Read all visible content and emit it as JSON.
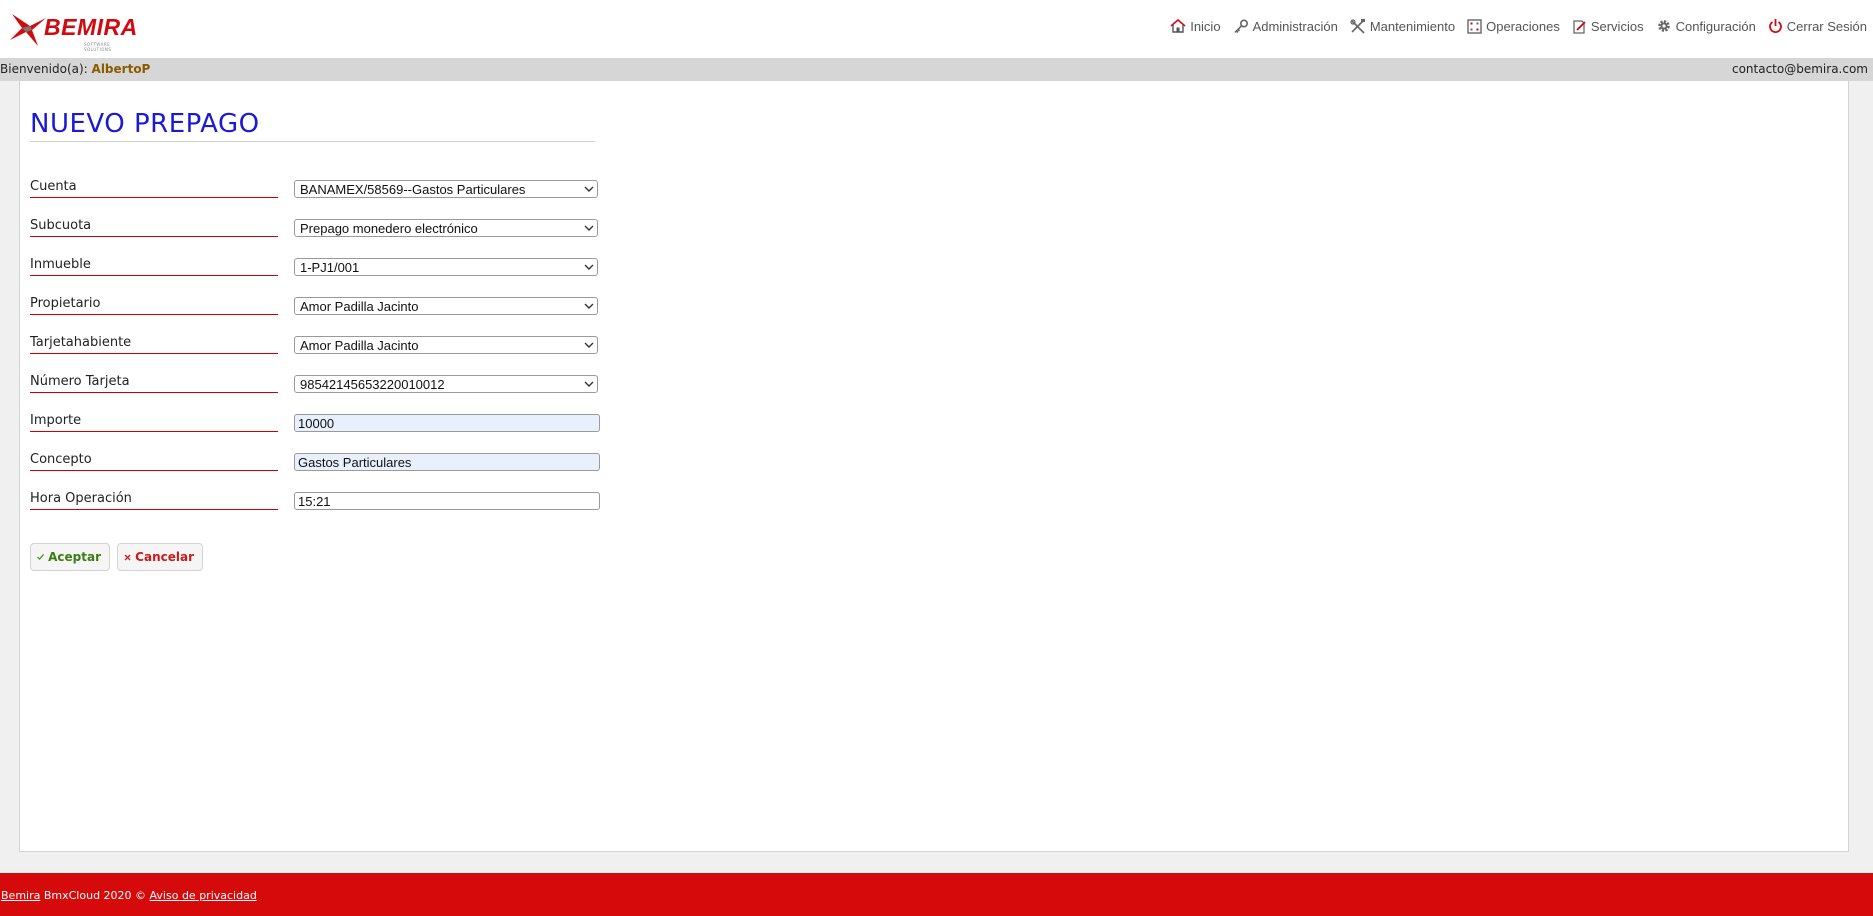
{
  "brand": {
    "logo_text": "BEMIRA",
    "logo_subtitle": "SOFTWARE SOLUTIONS",
    "accent_color": "#d10a10"
  },
  "nav": {
    "items": [
      {
        "label": "Inicio",
        "icon": "home-icon"
      },
      {
        "label": "Administración",
        "icon": "key-icon"
      },
      {
        "label": "Mantenimiento",
        "icon": "tools-icon"
      },
      {
        "label": "Operaciones",
        "icon": "calculator-icon"
      },
      {
        "label": "Servicios",
        "icon": "edit-document-icon"
      },
      {
        "label": "Configuración",
        "icon": "gear-icon"
      },
      {
        "label": "Cerrar Sesión",
        "icon": "power-icon"
      }
    ]
  },
  "welcome": {
    "prefix": "Bienvenido(a):",
    "user": "AlbertoP",
    "contact": "contacto@bemira.com"
  },
  "page": {
    "title": "NUEVO PREPAGO"
  },
  "form": {
    "fields": [
      {
        "label": "Cuenta",
        "value": "BANAMEX/58569--Gastos Particulares",
        "type": "select"
      },
      {
        "label": "Subcuota",
        "value": "Prepago monedero electrónico",
        "type": "select"
      },
      {
        "label": "Inmueble",
        "value": "1-PJ1/001",
        "type": "select"
      },
      {
        "label": "Propietario",
        "value": "Amor Padilla Jacinto",
        "type": "select"
      },
      {
        "label": "Tarjetahabiente",
        "value": "Amor Padilla Jacinto",
        "type": "select"
      },
      {
        "label": "Número Tarjeta",
        "value": "98542145653220010012",
        "type": "select"
      },
      {
        "label": "Importe",
        "value": "10000",
        "type": "text-filled"
      },
      {
        "label": "Concepto",
        "value": "Gastos Particulares",
        "type": "text-filled"
      },
      {
        "label": "Hora Operación",
        "value": "15:21",
        "type": "text"
      }
    ]
  },
  "actions": {
    "accept_label": "Aceptar",
    "cancel_label": "Cancelar"
  },
  "footer": {
    "brand_link": "Bemira",
    "text": " BmxCloud 2020 © ",
    "privacy_link": "Aviso de privacidad"
  }
}
